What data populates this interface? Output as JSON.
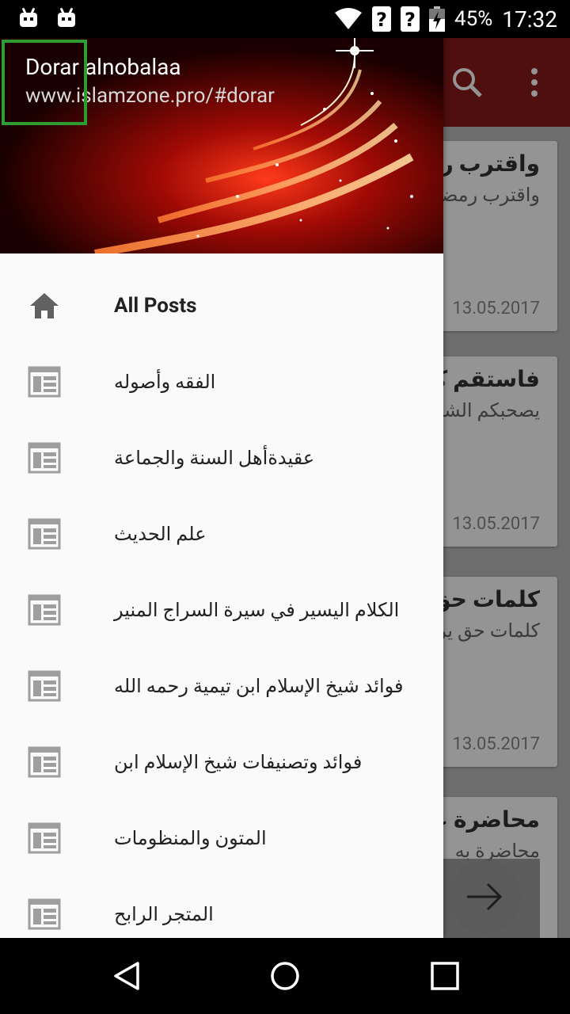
{
  "status_bar": {
    "battery": "45%",
    "time": "17:32"
  },
  "drawer": {
    "header": {
      "title": "Dorar alnobalaa",
      "subtitle": "www.islamzone.pro/#dorar"
    },
    "items": [
      {
        "label": "All Posts",
        "icon": "home-icon"
      },
      {
        "label": "الفقه وأصوله",
        "icon": "list-icon"
      },
      {
        "label": "عقيدةأهل السنة والجماعة",
        "icon": "list-icon"
      },
      {
        "label": "علم الحديث",
        "icon": "list-icon"
      },
      {
        "label": "الكلام اليسير في سيرة السراج المنير",
        "icon": "list-icon"
      },
      {
        "label": "فوائد شيخ الإسلام ابن تيمية رحمه الله",
        "icon": "list-icon"
      },
      {
        "label": "فوائد وتصنيفات شيخ الإسلام ابن",
        "icon": "list-icon"
      },
      {
        "label": "المتون والمنظومات",
        "icon": "list-icon"
      },
      {
        "label": "المتجر الرابح",
        "icon": "list-icon"
      }
    ]
  },
  "feed": {
    "cards": [
      {
        "title": "واقترب رمضان",
        "excerpt": "واقترب رمضان شهر الرحمة والغفران",
        "date": "13.05.2017"
      },
      {
        "title": "فاستقم كما أمرت",
        "excerpt": "يصحبكم الشيخ عبد العزيز الطريفي فك الله أسره",
        "date": "13.05.2017"
      },
      {
        "title": "كلمات حق يراد بها",
        "excerpt": "كلمات حق يراد بها باطل لفضيلة الشيخ",
        "date": "13.05.2017"
      },
      {
        "title": "محاضرة عن المهدي",
        "excerpt": "محاضرة به",
        "date": ""
      }
    ]
  },
  "colors": {
    "appbar": "#8a1a1a",
    "highlight_box": "#2e9c2e",
    "icon_gray": "#9e9e9e"
  }
}
